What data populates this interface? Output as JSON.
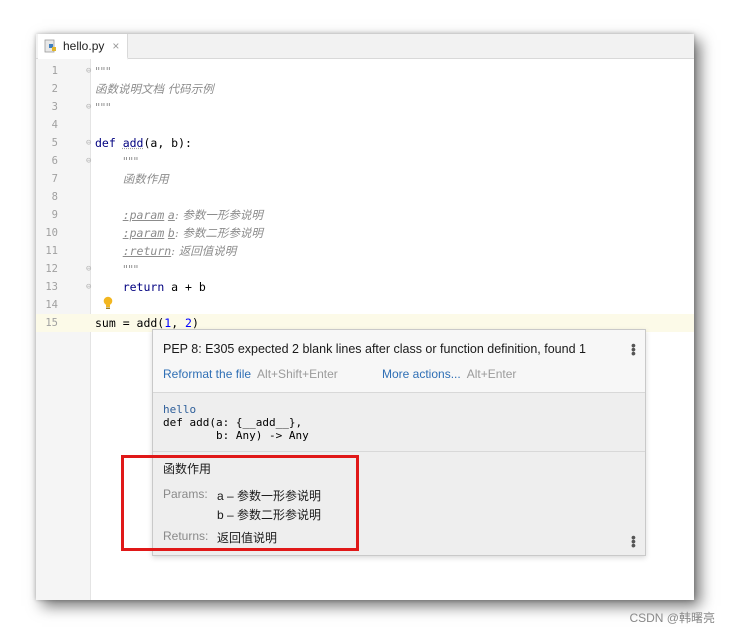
{
  "tab": {
    "filename": "hello.py",
    "close_glyph": "×"
  },
  "lines": [
    {
      "n": "1",
      "fold": "⊖",
      "parts": [
        {
          "cls": "doc",
          "t": "\"\"\""
        }
      ]
    },
    {
      "n": "2",
      "fold": "",
      "parts": [
        {
          "cls": "doc",
          "t": "函数说明文档 代码示例"
        }
      ]
    },
    {
      "n": "3",
      "fold": "⊖",
      "parts": [
        {
          "cls": "doc",
          "t": "\"\"\""
        }
      ]
    },
    {
      "n": "4",
      "fold": "",
      "parts": []
    },
    {
      "n": "5",
      "fold": "⊖",
      "parts": [
        {
          "cls": "kw",
          "t": "def "
        },
        {
          "cls": "fn",
          "t": "add"
        },
        {
          "cls": "",
          "t": "(a, b):"
        }
      ]
    },
    {
      "n": "6",
      "fold": "⊖",
      "parts": [
        {
          "cls": "",
          "t": "    "
        },
        {
          "cls": "doc",
          "t": "\"\"\""
        }
      ]
    },
    {
      "n": "7",
      "fold": "",
      "parts": [
        {
          "cls": "",
          "t": "    "
        },
        {
          "cls": "doc",
          "t": "函数作用"
        }
      ]
    },
    {
      "n": "8",
      "fold": "",
      "parts": []
    },
    {
      "n": "9",
      "fold": "",
      "parts": [
        {
          "cls": "",
          "t": "    "
        },
        {
          "cls": "tag",
          "t": ":param"
        },
        {
          "cls": "doc",
          "t": " "
        },
        {
          "cls": "tag",
          "t": "a"
        },
        {
          "cls": "doc",
          "t": ": 参数一形参说明"
        }
      ]
    },
    {
      "n": "10",
      "fold": "",
      "parts": [
        {
          "cls": "",
          "t": "    "
        },
        {
          "cls": "tag",
          "t": ":param"
        },
        {
          "cls": "doc",
          "t": " "
        },
        {
          "cls": "tag",
          "t": "b"
        },
        {
          "cls": "doc",
          "t": ": 参数二形参说明"
        }
      ]
    },
    {
      "n": "11",
      "fold": "",
      "parts": [
        {
          "cls": "",
          "t": "    "
        },
        {
          "cls": "tag",
          "t": ":return"
        },
        {
          "cls": "doc",
          "t": ": 返回值说明"
        }
      ]
    },
    {
      "n": "12",
      "fold": "⊖",
      "parts": [
        {
          "cls": "",
          "t": "    "
        },
        {
          "cls": "doc",
          "t": "\"\"\""
        }
      ]
    },
    {
      "n": "13",
      "fold": "⊖",
      "parts": [
        {
          "cls": "",
          "t": "    "
        },
        {
          "cls": "kw",
          "t": "return"
        },
        {
          "cls": "",
          "t": " a + b"
        }
      ]
    },
    {
      "n": "14",
      "fold": "",
      "parts": []
    },
    {
      "n": "15",
      "fold": "",
      "current": true,
      "parts": [
        {
          "cls": "",
          "t": "sum = add("
        },
        {
          "cls": "num",
          "t": "1"
        },
        {
          "cls": "",
          "t": ", "
        },
        {
          "cls": "num",
          "t": "2"
        },
        {
          "cls": "",
          "t": ")"
        }
      ]
    }
  ],
  "popup": {
    "warning": "PEP 8: E305 expected 2 blank lines after class or function definition, found 1",
    "reformat_label": "Reformat the file",
    "reformat_shortcut": "Alt+Shift+Enter",
    "more_label": "More actions...",
    "more_shortcut": "Alt+Enter",
    "module": "hello",
    "sig_line1": "def add(a: {__add__},",
    "sig_line2": "        b: Any) -> Any",
    "doc_summary": "函数作用",
    "params_label": "Params:",
    "param_a": "a – 参数一形参说明",
    "param_b": "b – 参数二形参说明",
    "returns_label": "Returns:",
    "returns_text": "返回值说明"
  },
  "watermark": "CSDN @韩曙亮",
  "colors": {
    "highlight_box": "#e01818",
    "link": "#2f6fb5",
    "keyword": "#000080"
  }
}
